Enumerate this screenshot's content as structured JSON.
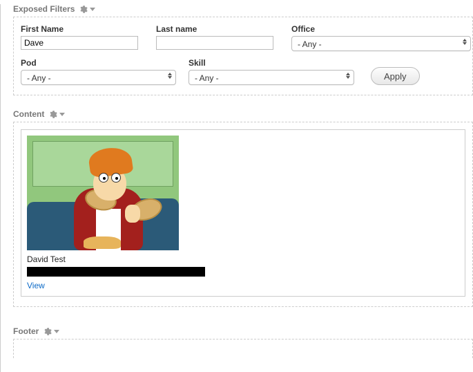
{
  "sections": {
    "exposed_filters": "Exposed Filters",
    "content": "Content",
    "footer": "Footer"
  },
  "filters": {
    "first_name": {
      "label": "First Name",
      "value": "Dave"
    },
    "last_name": {
      "label": "Last name",
      "value": ""
    },
    "office": {
      "label": "Office",
      "selected": "- Any -"
    },
    "pod": {
      "label": "Pod",
      "selected": "- Any -"
    },
    "skill": {
      "label": "Skill",
      "selected": "- Any -"
    },
    "apply_label": "Apply"
  },
  "content": {
    "item": {
      "title": "David Test",
      "view_label": "View"
    }
  }
}
